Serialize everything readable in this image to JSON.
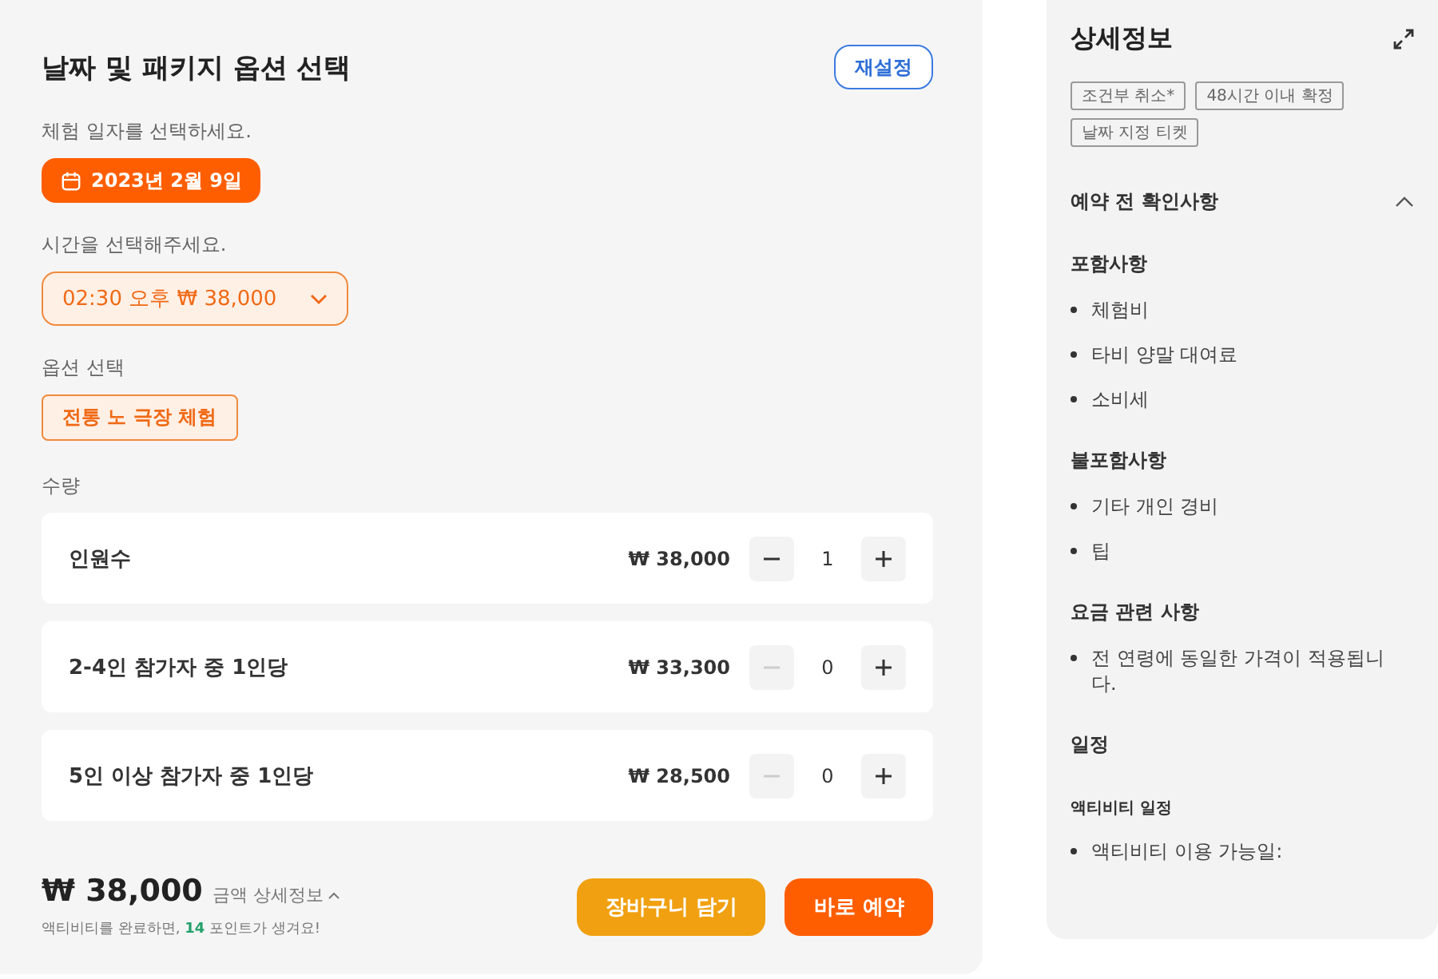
{
  "booking": {
    "title": "날짜 및 패키지 옵션 선택",
    "reset_button": "재설정",
    "date_label": "체험 일자를 선택하세요.",
    "date": "2023년 2월 9일",
    "time_label": "시간을 선택해주세요.",
    "time_value": "02:30 오후 ₩ 38,000",
    "option_label": "옵션 선택",
    "options": [
      {
        "label": "전통 노 극장 체험",
        "selected": true
      }
    ],
    "quantity_label": "수량",
    "quantities": [
      {
        "name": "인원수",
        "price": "₩ 38,000",
        "count": "1",
        "minus_disabled": false
      },
      {
        "name": "2-4인 참가자 중 1인당",
        "price": "₩ 33,300",
        "count": "0",
        "minus_disabled": true
      },
      {
        "name": "5인 이상 참가자 중 1인당",
        "price": "₩ 28,500",
        "count": "0",
        "minus_disabled": true
      }
    ],
    "total": "₩ 38,000",
    "total_details": "금액 상세정보",
    "points_note": "액티비티를 완료하면, **14** 포인트가 생겨요!",
    "cart_button": "장바구니 담기",
    "book_button": "바로 예약"
  },
  "details": {
    "title": "상세정보",
    "tags": [
      "조건부 취소*",
      "48시간 이내 확정",
      "날짜 지정 티켓"
    ],
    "section": {
      "title": "예약 전 확인사항",
      "expanded": true
    },
    "groups": [
      {
        "heading": "포함사항",
        "items": [
          "체험비",
          "타비 양말 대여료",
          "소비세"
        ]
      },
      {
        "heading": "불포함사항",
        "items": [
          "기타 개인 경비",
          "팁"
        ]
      },
      {
        "heading": "요금 관련 사항",
        "items": [
          "전 연령에 동일한 가격이 적용됩니다."
        ]
      }
    ],
    "schedule_title": "일정",
    "schedule_subtitle": "액티비티 일정",
    "schedule_items": [
      "액티비티 이용 가능일:"
    ]
  }
}
